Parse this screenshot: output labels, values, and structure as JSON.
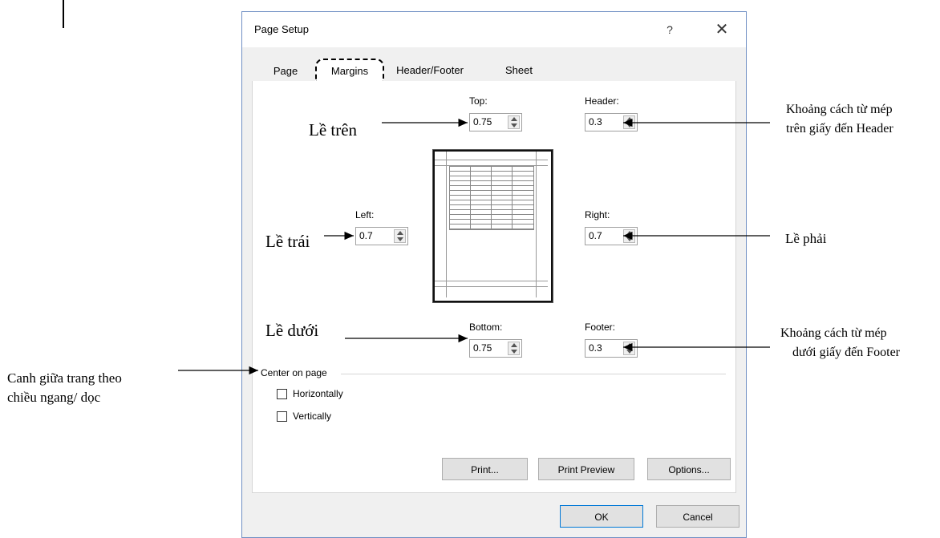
{
  "dialog": {
    "title": "Page Setup",
    "help": "?",
    "close": "✕",
    "tabs": [
      "Page",
      "Margins",
      "Header/Footer",
      "Sheet"
    ],
    "fields": {
      "top": {
        "label": "Top:",
        "value": "0.75"
      },
      "header": {
        "label": "Header:",
        "value": "0.3"
      },
      "left": {
        "label": "Left:",
        "value": "0.7"
      },
      "right": {
        "label": "Right:",
        "value": "0.7"
      },
      "bottom": {
        "label": "Bottom:",
        "value": "0.75"
      },
      "footer": {
        "label": "Footer:",
        "value": "0.3"
      }
    },
    "center_group": "Center on page",
    "horizontally": "Horizontally",
    "vertically": "Vertically",
    "print": "Print...",
    "print_preview": "Print Preview",
    "options": "Options...",
    "ok": "OK",
    "cancel": "Cancel"
  },
  "annotations": {
    "le_tren": "Lề trên",
    "le_trai": "Lề trái",
    "le_duoi": "Lề dưới",
    "le_phai": "Lề phải",
    "header_note_1": "Khoảng cách từ mép",
    "header_note_2": "trên giấy đến Header",
    "footer_note_1": "Khoảng cách từ mép",
    "footer_note_2": "dưới  giấy đến Footer",
    "center_note_1": "Canh giữa trang theo",
    "center_note_2": "chiều ngang/ dọc"
  }
}
